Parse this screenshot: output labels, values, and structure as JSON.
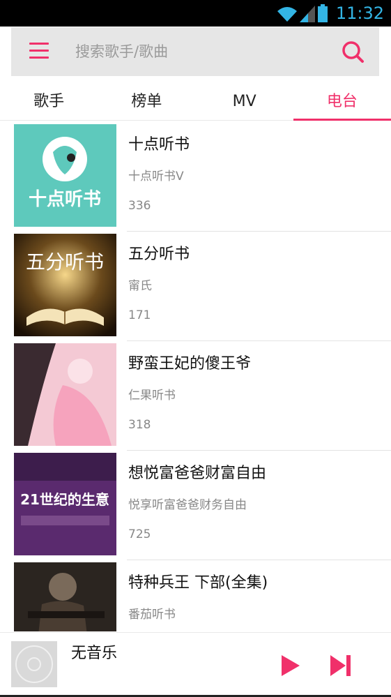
{
  "status_bar": {
    "time": "11:32",
    "icons": [
      "wifi-icon",
      "signal-icon",
      "battery-icon"
    ],
    "accent": "#33b5e5"
  },
  "search": {
    "placeholder": "搜索歌手/歌曲",
    "menu_icon": "menu-icon",
    "search_icon": "search-icon"
  },
  "tabs": [
    {
      "label": "歌手",
      "active": false
    },
    {
      "label": "榜单",
      "active": false
    },
    {
      "label": "MV",
      "active": false
    },
    {
      "label": "电台",
      "active": true
    }
  ],
  "colors": {
    "accent": "#f0306a",
    "search_bg": "#e6e6e6",
    "text_secondary": "#888888"
  },
  "stations": [
    {
      "title": "十点听书",
      "subtitle": "十点听书V",
      "count": "336",
      "cover_text": "十点听书"
    },
    {
      "title": "五分听书",
      "subtitle": "甯氏",
      "count": "171",
      "cover_text": "五分听书"
    },
    {
      "title": "野蛮王妃的傻王爷",
      "subtitle": "仁果听书",
      "count": "318",
      "cover_text": ""
    },
    {
      "title": "想悦富爸爸财富自由",
      "subtitle": "悦享听富爸爸财务自由",
      "count": "725",
      "cover_text": "21世纪的生意"
    },
    {
      "title": "特种兵王 下部(全集)",
      "subtitle": "番茄听书",
      "count": "",
      "cover_text": ""
    }
  ],
  "player": {
    "track": "无音乐",
    "play_icon": "play-icon",
    "next_icon": "skip-next-icon"
  }
}
